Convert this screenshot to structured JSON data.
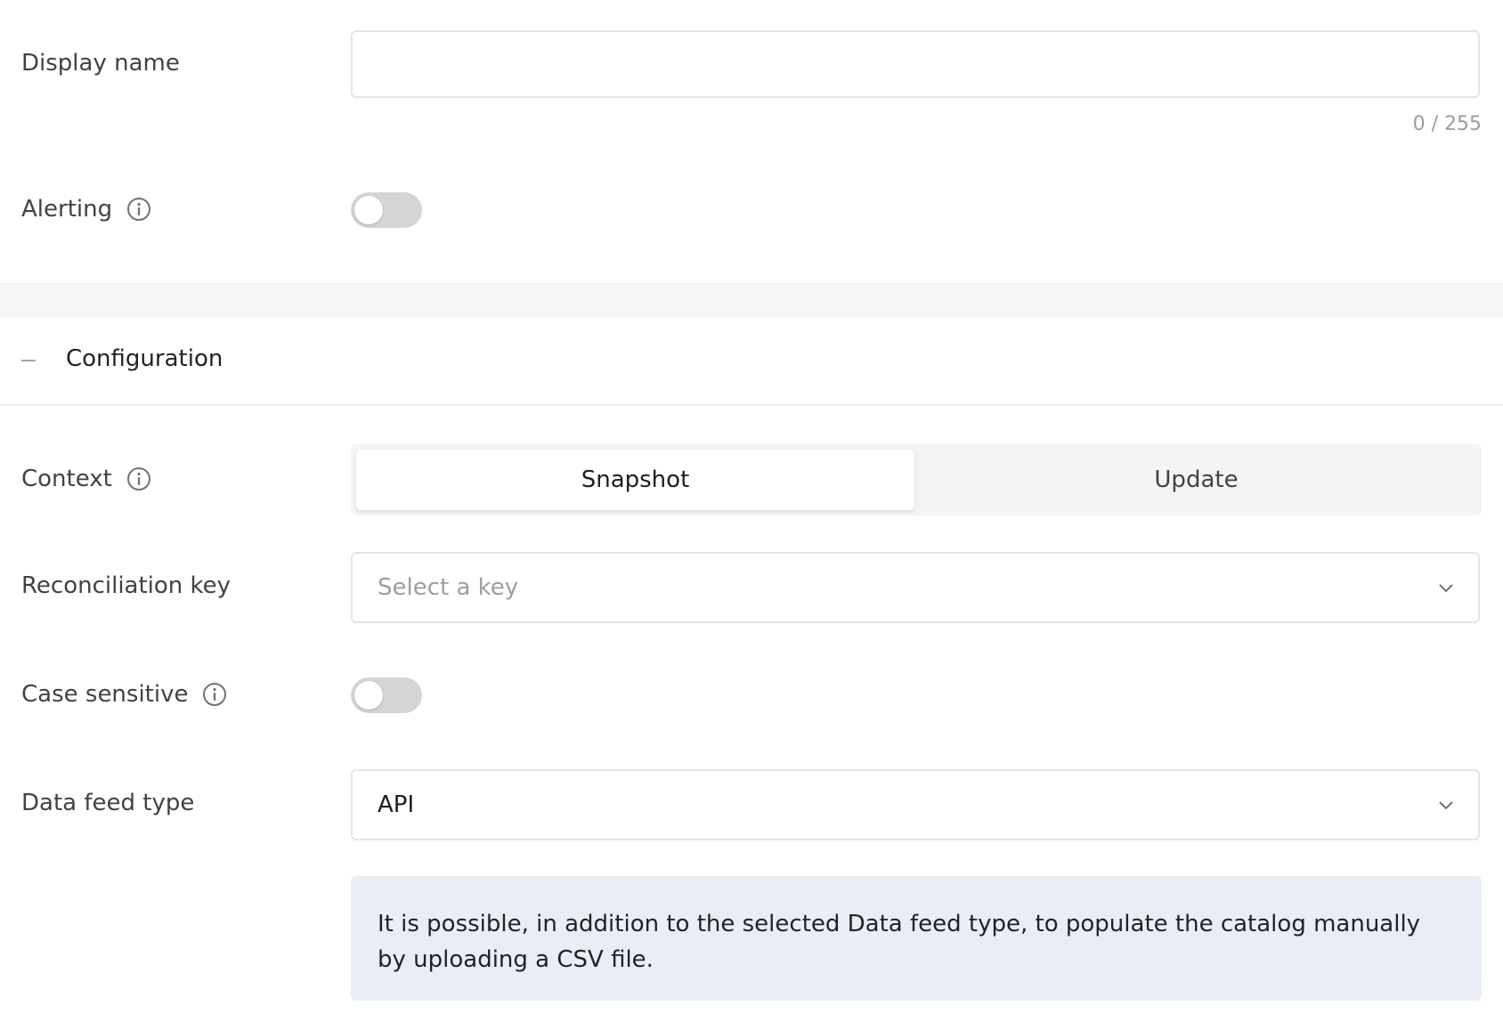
{
  "fields": {
    "display_name": {
      "label": "Display name",
      "value": "",
      "char_count": "0 / 255"
    },
    "alerting": {
      "label": "Alerting",
      "enabled": false,
      "info_icon": "info-icon"
    }
  },
  "configuration": {
    "title": "Configuration",
    "expanded": true,
    "context": {
      "label": "Context",
      "options": [
        "Snapshot",
        "Update"
      ],
      "selected": "Snapshot"
    },
    "reconciliation_key": {
      "label": "Reconciliation key",
      "placeholder": "Select a key",
      "value": ""
    },
    "case_sensitive": {
      "label": "Case sensitive",
      "enabled": false
    },
    "data_feed_type": {
      "label": "Data feed type",
      "value": "API"
    },
    "notice": "It is possible, in addition to the selected Data feed type, to populate the catalog manually by uploading a CSV file."
  },
  "colors": {
    "notice_bg": "#e9eef5",
    "toggle_off": "#d4d5d7",
    "border": "#e4e5e7"
  }
}
